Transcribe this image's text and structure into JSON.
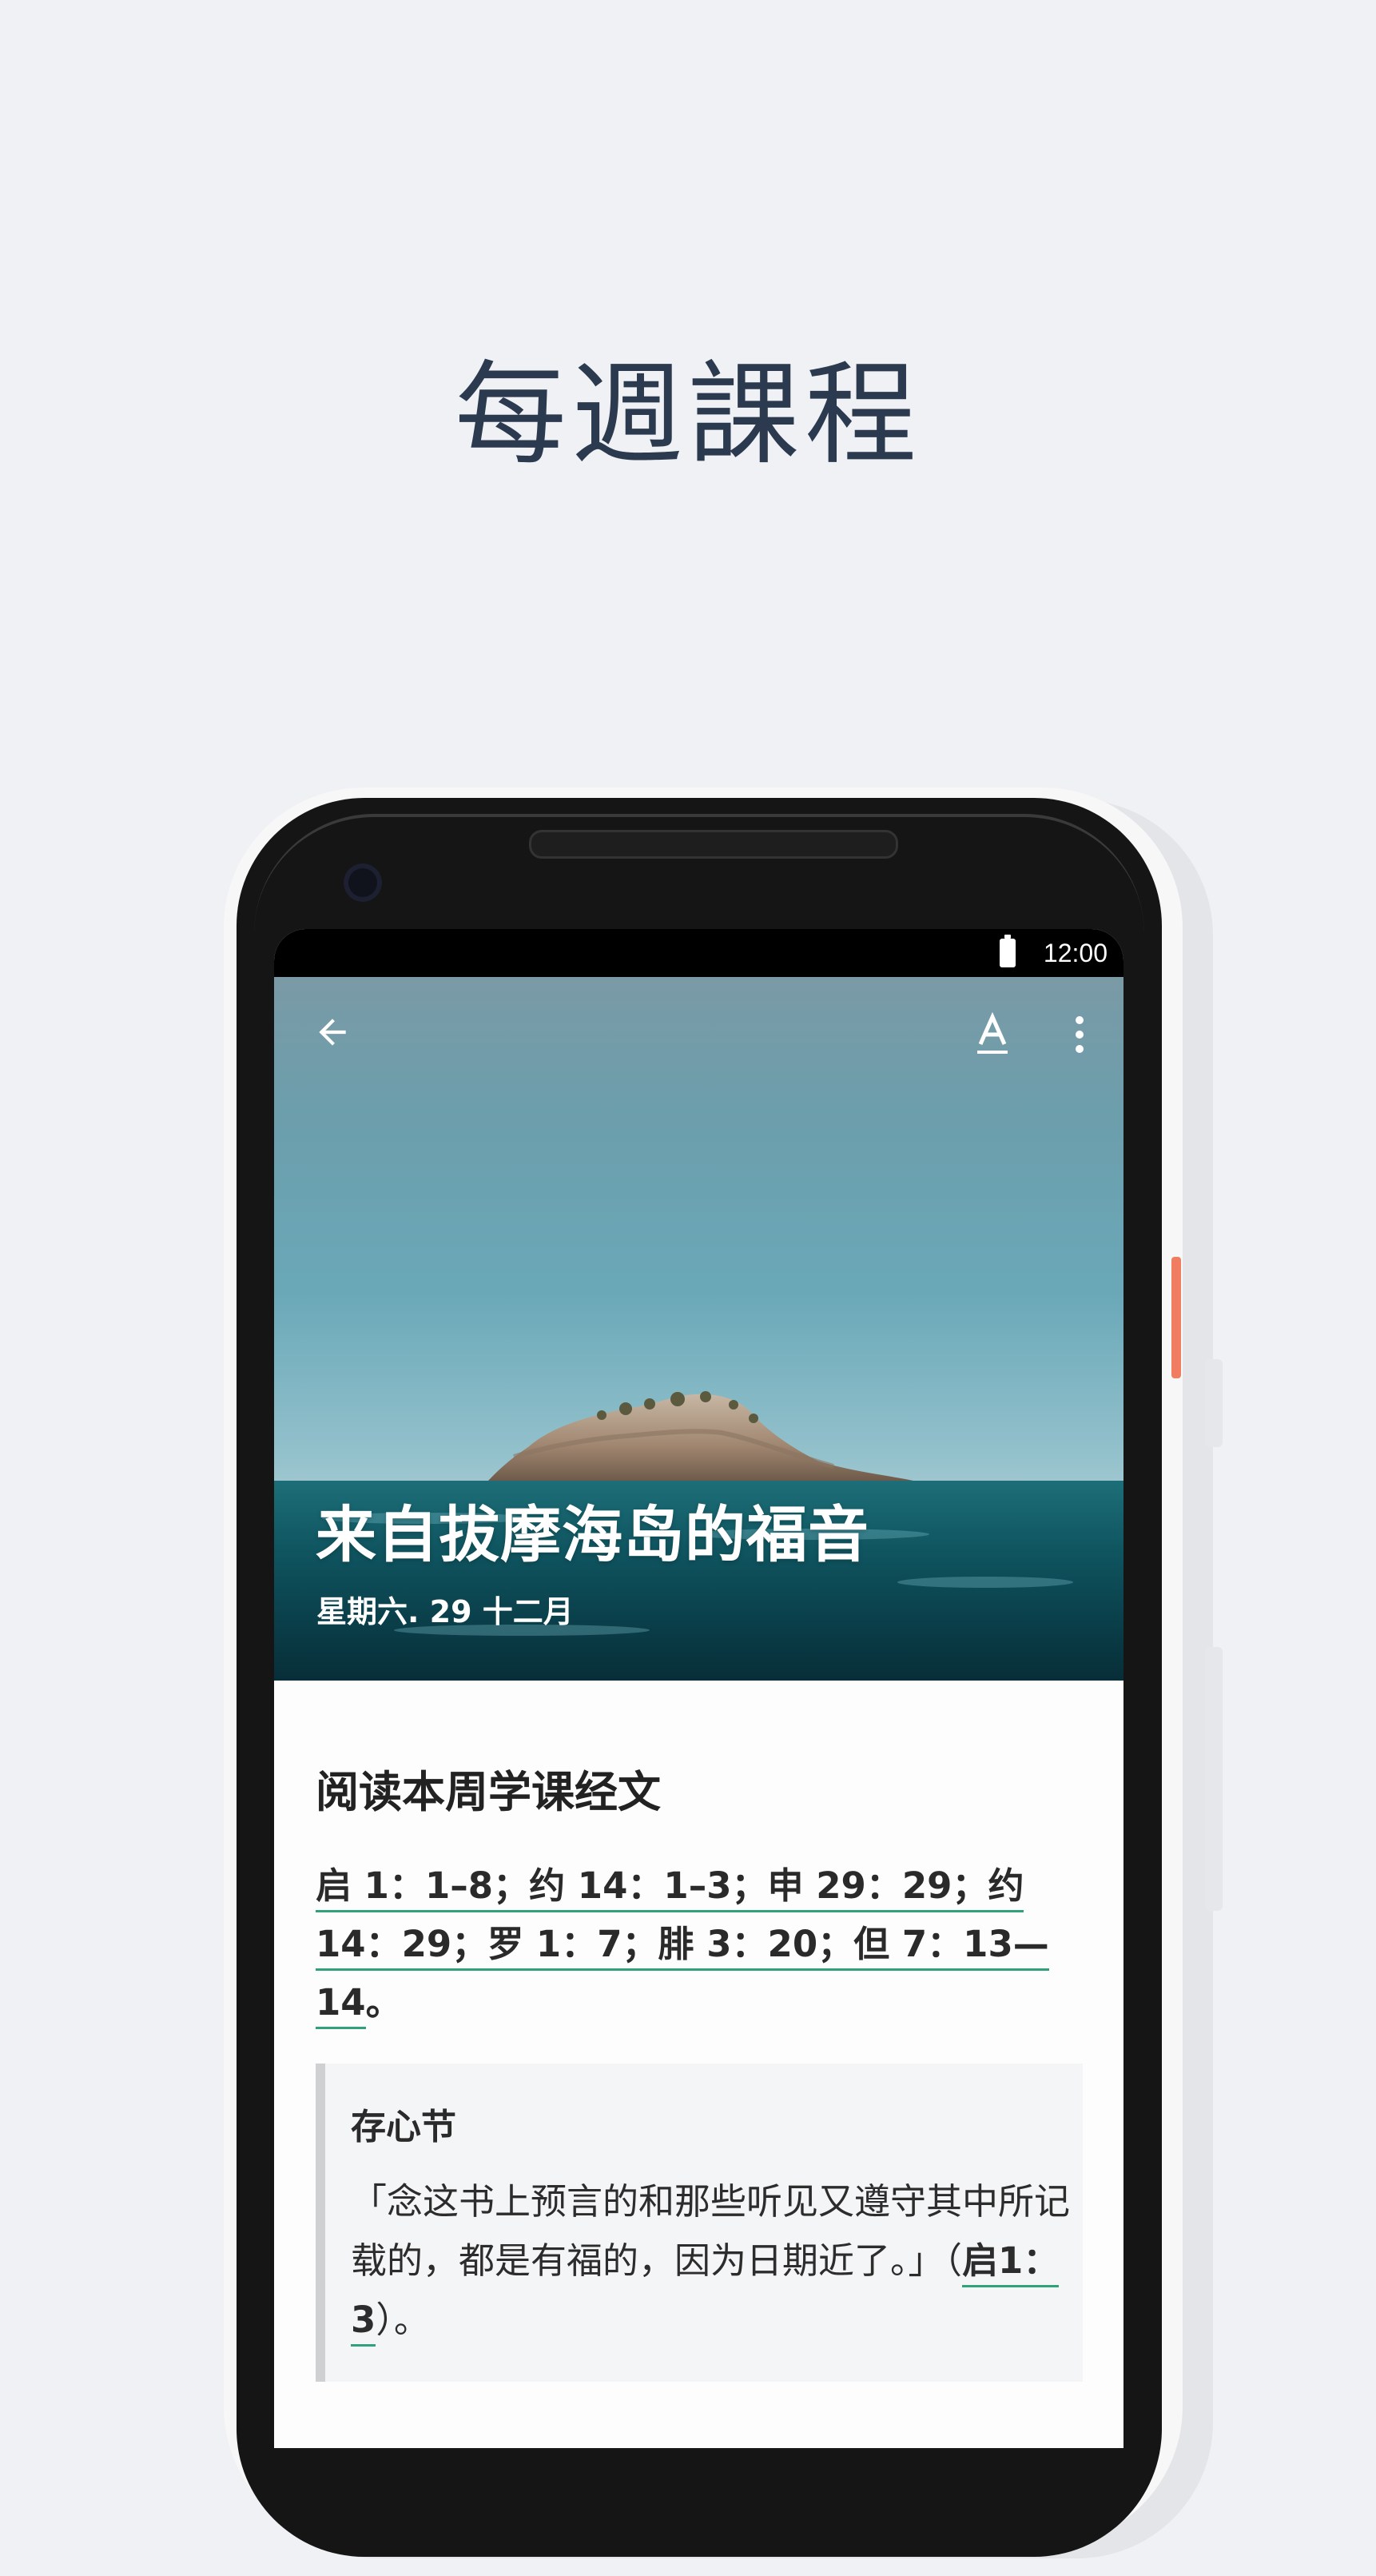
{
  "headline": "每週課程",
  "status_bar": {
    "time": "12:00"
  },
  "lesson": {
    "title": "来自拔摩海岛的福音",
    "date": "星期六. 29 十二月",
    "reading_heading": "阅读本周学课经文",
    "scripture_refs": [
      "启 1：1–8",
      "；约 14：1–3",
      "；申 29：29",
      "；约 14：29",
      "；罗 1：7",
      "；腓 3：20",
      "；但 7：13—14",
      "。"
    ],
    "memory_verse": {
      "title": "存心节",
      "text": "「念这书上预言的和那些听见又遵守其中所记载的，都是有福的，因为日期近了。」（",
      "ref": "启1：3",
      "suffix": "）。"
    }
  },
  "toolbar": {
    "back_icon": "arrow-left-icon",
    "font_icon": "text-format-icon",
    "more_icon": "more-vert-icon"
  },
  "colors": {
    "background": "#eff1f4",
    "headline": "#2c3a50",
    "link_underline": "#2fa27a",
    "power_button": "#f07d62"
  }
}
